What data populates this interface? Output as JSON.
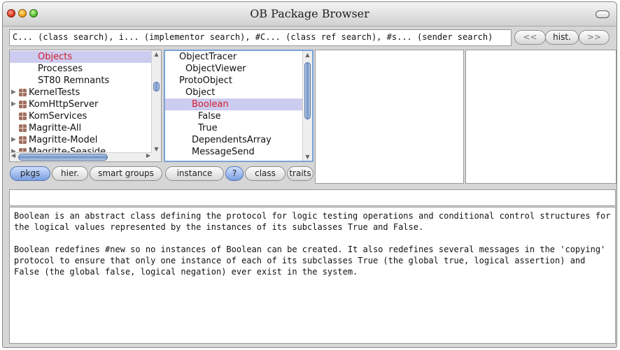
{
  "window": {
    "title": "OB Package Browser"
  },
  "search": {
    "text": "C... (class search), i... (implementor search), #C... (class ref search), #s... (sender search)"
  },
  "history": {
    "back_label": "<<",
    "hist_label": "hist.",
    "forward_label": ">>"
  },
  "packages": {
    "items": [
      {
        "label": "Objects",
        "selected": true
      },
      {
        "label": "Processes"
      },
      {
        "label": "ST80 Remnants"
      },
      {
        "label": "KernelTests"
      },
      {
        "label": "KomHttpServer"
      },
      {
        "label": "KomServices"
      },
      {
        "label": "Magritte-All"
      },
      {
        "label": "Magritte-Model"
      },
      {
        "label": "Magritte-Seaside"
      }
    ]
  },
  "classes": {
    "items": [
      {
        "label": "ObjectTracer"
      },
      {
        "label": "ObjectViewer"
      },
      {
        "label": "ProtoObject"
      },
      {
        "label": "Object"
      },
      {
        "label": "Boolean",
        "selected": true
      },
      {
        "label": "False"
      },
      {
        "label": "True"
      },
      {
        "label": "DependentsArray"
      },
      {
        "label": "MessageSend"
      }
    ]
  },
  "package_buttons": {
    "pkgs": "pkgs",
    "hier": "hier.",
    "smart_groups": "smart groups"
  },
  "class_buttons": {
    "instance": "instance",
    "help": "?",
    "class": "class",
    "traits": "traits"
  },
  "comment": {
    "paragraph1": "Boolean is an abstract class defining the protocol for logic testing operations and conditional control structures for the logical values represented by the instances of its subclasses True and False.",
    "paragraph2": "Boolean redefines #new so no instances of Boolean can be created. It also redefines several messages in the 'copying' protocol to ensure that only one instance of each of its subclasses True (the global true, logical assertion) and False (the global false, logical negation) ever exist in the system."
  }
}
